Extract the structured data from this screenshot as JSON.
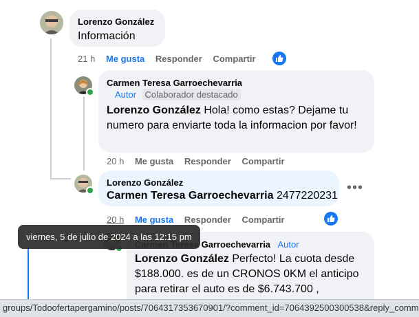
{
  "comment1": {
    "author": "Lorenzo González",
    "text": "Información",
    "time": "21 h",
    "like": "Me gusta",
    "reply": "Responder",
    "share": "Compartir"
  },
  "reply1": {
    "author": "Carmen Teresa Garroechevarria",
    "role": "Autor",
    "badge": "Colaborador destacado",
    "mention": "Lorenzo González",
    "text": " Hola! como estas? Dejame tu numero para enviarte toda la informacion por favor!",
    "time": "20 h",
    "like": "Me gusta",
    "reply": "Responder",
    "share": "Compartir"
  },
  "reply2": {
    "author": "Lorenzo González",
    "mention": "Carmen Teresa Garroechevarria",
    "text": " 2477220231",
    "time": "20 h",
    "like": "Me gusta",
    "reply": "Responder",
    "share": "Compartir"
  },
  "reply3": {
    "author": "Carmen Teresa Garroechevarria",
    "role": "Autor",
    "mention": "Lorenzo González",
    "text": " Perfecto! La cuota desde $188.000. es de un CRONOS 0KM el anticipo para retirar el auto es de $6.743.700 ,"
  },
  "tooltip": "viernes, 5 de julio de 2024 a las 12:15 pm",
  "status_url": "groups/Todoofertapergamino/posts/7064317353670901/?comment_id=7064392500300538&reply_comment_id=70",
  "colors": {
    "accent": "#1877f2",
    "bubble": "#f0f2f5",
    "online": "#31a24c"
  }
}
